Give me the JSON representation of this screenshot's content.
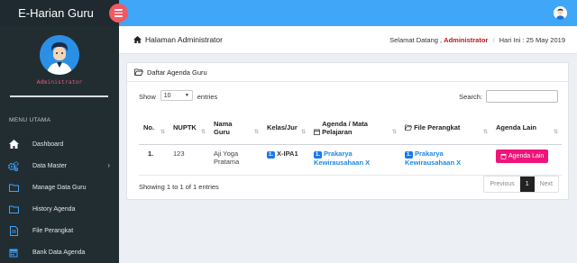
{
  "sidebar": {
    "brand": "E-Harian Guru",
    "user_name": "Administrator",
    "menu_header": "MENU UTAMA",
    "items": [
      {
        "label": "Dashboard",
        "icon": "home-icon"
      },
      {
        "label": "Data Master",
        "icon": "cogs-icon"
      },
      {
        "label": "Manage Data Guru",
        "icon": "folder-icon"
      },
      {
        "label": "History Agenda",
        "icon": "folder-icon"
      },
      {
        "label": "File Perangkat",
        "icon": "file-icon"
      },
      {
        "label": "Bank Data Agenda",
        "icon": "calendar-icon"
      }
    ]
  },
  "header": {
    "title": "Halaman Administrator",
    "welcome": "Selamat Datang ,",
    "user": "Administrator",
    "date": "Hari Ini : 25 May 2019"
  },
  "card": {
    "title": "Daftar Agenda Guru",
    "show_label": "Show",
    "entries_value": "10",
    "entries_label": "entries",
    "search_label": "Search:",
    "columns": [
      "No.",
      "NUPTK",
      "Nama Guru",
      "Kelas/Jur",
      "Agenda / Mata Pelajaran",
      "File Perangkat",
      "Agenda Lain"
    ],
    "rows": [
      {
        "no": "1.",
        "nuptk": "123",
        "nama": "Aji Yoga Pratama",
        "kelas_badge": "1.",
        "kelas": "X-IPA1",
        "agenda_badge": "1.",
        "agenda": "Prakarya Kewirausahaan X",
        "file_badge": "1.",
        "file": "Prakarya Kewirausahaan X",
        "button": "Agenda Lain"
      }
    ],
    "info": "Showing 1 to 1 of 1 entries",
    "pager": {
      "previous": "Previous",
      "current": "1",
      "next": "Next"
    }
  },
  "colors": {
    "sidebar": "#222d32",
    "topbar": "#3fa6f8",
    "toggle": "#f25961",
    "accent_pink": "#f0147a",
    "badge_blue": "#1877f2"
  }
}
